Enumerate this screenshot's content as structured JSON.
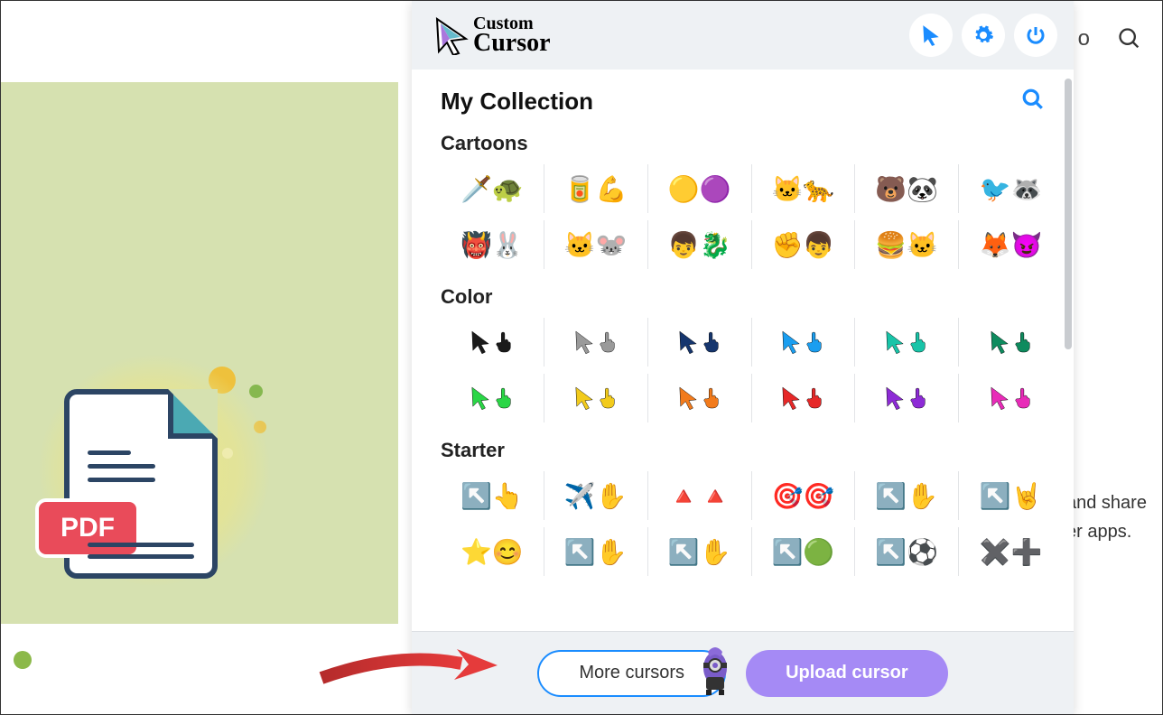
{
  "background": {
    "pdf_label": "PDF",
    "right_text_line1": "and share",
    "right_text_line2": "er apps.",
    "header_partial": "o"
  },
  "popup": {
    "logo": {
      "line1": "Custom",
      "line2": "Cursor"
    },
    "header_buttons": [
      "cursor",
      "settings",
      "power"
    ],
    "my_collection_title": "My Collection",
    "categories": [
      {
        "name": "Cartoons",
        "rows": [
          [
            {
              "name": "tmnt",
              "emojis": "🗡️🐢"
            },
            {
              "name": "popeye",
              "emojis": "🥫💪"
            },
            {
              "name": "minions",
              "emojis": "🟡🟣"
            },
            {
              "name": "felix",
              "emojis": "🐱🐆"
            },
            {
              "name": "bears",
              "emojis": "🐻🐼"
            },
            {
              "name": "regular",
              "emojis": "🐦🦝"
            }
          ],
          [
            {
              "name": "shrek",
              "emojis": "👹🐰"
            },
            {
              "name": "tom-jerry",
              "emojis": "🐱🐭"
            },
            {
              "name": "dragon",
              "emojis": "👦🐉"
            },
            {
              "name": "ben10",
              "emojis": "✊👦"
            },
            {
              "name": "garfield",
              "emojis": "🍔🐱"
            },
            {
              "name": "grinch",
              "emojis": "🦊😈"
            }
          ]
        ]
      },
      {
        "name": "Color",
        "rows": [
          [
            {
              "name": "black",
              "color": "#1a1a1a"
            },
            {
              "name": "gray",
              "color": "#9a9a9a"
            },
            {
              "name": "navy",
              "color": "#16366e"
            },
            {
              "name": "blue",
              "color": "#1a9ef0"
            },
            {
              "name": "teal",
              "color": "#18c4a8"
            },
            {
              "name": "darkgreen",
              "color": "#0e8b5e"
            }
          ],
          [
            {
              "name": "green",
              "color": "#2ad646"
            },
            {
              "name": "yellow",
              "color": "#f2cb1c"
            },
            {
              "name": "orange",
              "color": "#f27b1c"
            },
            {
              "name": "red",
              "color": "#e62828"
            },
            {
              "name": "purple",
              "color": "#8d2bd6"
            },
            {
              "name": "magenta",
              "color": "#e82bb8"
            }
          ]
        ]
      },
      {
        "name": "Starter",
        "rows": [
          [
            {
              "name": "aqua",
              "emojis": "↖️👆"
            },
            {
              "name": "paper-plane",
              "emojis": "✈️✋"
            },
            {
              "name": "stone",
              "emojis": "🔺🔺"
            },
            {
              "name": "crosshair",
              "emojis": "🎯🎯"
            },
            {
              "name": "outline",
              "emojis": "↖️✋"
            },
            {
              "name": "pixel",
              "emojis": "↖️🤘"
            }
          ],
          [
            {
              "name": "smiley",
              "emojis": "⭐😊"
            },
            {
              "name": "rainbow",
              "emojis": "↖️✋"
            },
            {
              "name": "holo",
              "emojis": "↖️✋"
            },
            {
              "name": "slime",
              "emojis": "↖️🟢"
            },
            {
              "name": "soccer",
              "emojis": "↖️⚽"
            },
            {
              "name": "patch",
              "emojis": "✖️➕"
            }
          ]
        ]
      }
    ],
    "footer": {
      "more_label": "More cursors",
      "upload_label": "Upload cursor"
    }
  }
}
